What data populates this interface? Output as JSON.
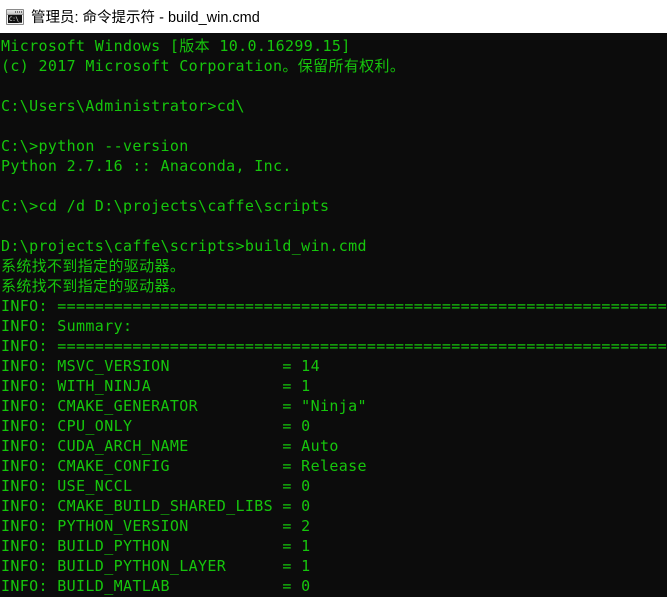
{
  "window": {
    "title": "管理员: 命令提示符 - build_win.cmd",
    "icon": "cmd-console-icon",
    "icon_glyph": "C:\\_",
    "titlebar_bg": "#ffffff",
    "titlebar_fg": "#000000"
  },
  "console": {
    "background": "#0c0c0c",
    "foreground": "#16c60c",
    "lines": [
      "Microsoft Windows [版本 10.0.16299.15]",
      "(c) 2017 Microsoft Corporation。保留所有权利。",
      "",
      "C:\\Users\\Administrator>cd\\",
      "",
      "C:\\>python --version",
      "Python 2.7.16 :: Anaconda, Inc.",
      "",
      "C:\\>cd /d D:\\projects\\caffe\\scripts",
      "",
      "D:\\projects\\caffe\\scripts>build_win.cmd",
      "系统找不到指定的驱动器。",
      "系统找不到指定的驱动器。",
      "INFO: ============================================================================",
      "INFO: Summary:",
      "INFO: ============================================================================",
      "INFO: MSVC_VERSION            = 14",
      "INFO: WITH_NINJA              = 1",
      "INFO: CMAKE_GENERATOR         = \"Ninja\"",
      "INFO: CPU_ONLY                = 0",
      "INFO: CUDA_ARCH_NAME          = Auto",
      "INFO: CMAKE_CONFIG            = Release",
      "INFO: USE_NCCL                = 0",
      "INFO: CMAKE_BUILD_SHARED_LIBS = 0",
      "INFO: PYTHON_VERSION          = 2",
      "INFO: BUILD_PYTHON            = 1",
      "INFO: BUILD_PYTHON_LAYER      = 1",
      "INFO: BUILD_MATLAB            = 0"
    ],
    "summary_settings": [
      {
        "key": "MSVC_VERSION",
        "value": "14"
      },
      {
        "key": "WITH_NINJA",
        "value": "1"
      },
      {
        "key": "CMAKE_GENERATOR",
        "value": "\"Ninja\""
      },
      {
        "key": "CPU_ONLY",
        "value": "0"
      },
      {
        "key": "CUDA_ARCH_NAME",
        "value": "Auto"
      },
      {
        "key": "CMAKE_CONFIG",
        "value": "Release"
      },
      {
        "key": "USE_NCCL",
        "value": "0"
      },
      {
        "key": "CMAKE_BUILD_SHARED_LIBS",
        "value": "0"
      },
      {
        "key": "PYTHON_VERSION",
        "value": "2"
      },
      {
        "key": "BUILD_PYTHON",
        "value": "1"
      },
      {
        "key": "BUILD_PYTHON_LAYER",
        "value": "1"
      },
      {
        "key": "BUILD_MATLAB",
        "value": "0"
      }
    ]
  }
}
